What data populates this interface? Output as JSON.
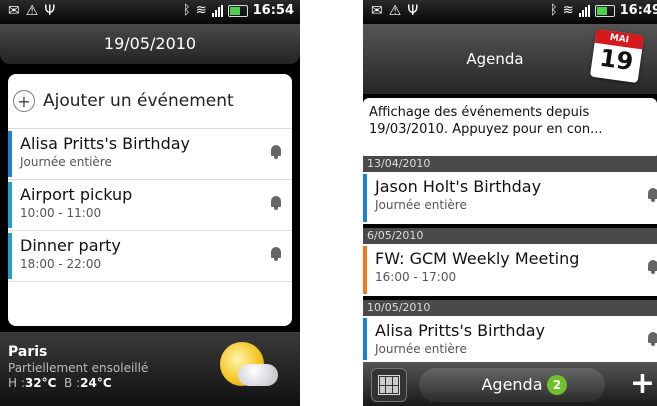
{
  "left": {
    "status_time": "16:54",
    "date": "19/05/2010",
    "add_event_label": "Ajouter un événement",
    "events": [
      {
        "title": "Alisa Pritts's Birthday",
        "time": "Journée entière",
        "color": "#1d7fd1"
      },
      {
        "title": "Airport pickup",
        "time": "10:00 - 11:00",
        "color": "#21a0c9"
      },
      {
        "title": "Dinner party",
        "time": "18:00 - 22:00",
        "color": "#21a0c9"
      }
    ],
    "weather": {
      "city": "Paris",
      "description": "Partiellement ensoleillé",
      "high_label": "H :",
      "high": "32°C",
      "low_label": "B :",
      "low": "24°C"
    }
  },
  "right": {
    "status_time": "16:49",
    "header_title": "Agenda",
    "calendar_icon": {
      "month": "MAI",
      "day": "19"
    },
    "info_text": "Affichage des événements depuis 19/03/2010. Appuyez pour en con...",
    "groups": [
      {
        "date": "13/04/2010",
        "title": "Jason Holt's Birthday",
        "time": "Journée entière",
        "color": "#1d7fd1"
      },
      {
        "date": "6/05/2010",
        "title": "FW: GCM Weekly Meeting",
        "time": "16:00 - 17:00",
        "color": "#f07a1c"
      },
      {
        "date": "10/05/2010",
        "title": "Alisa Pritts's Birthday",
        "time": "Journée entière",
        "color": "#1d7fd1"
      }
    ],
    "bottom_label": "Agenda",
    "bottom_count": "2"
  },
  "icons": [
    "mail-icon",
    "warning-icon",
    "usb-icon",
    "bluetooth-icon",
    "wifi-icon",
    "signal-icon",
    "battery-icon",
    "bell-icon",
    "add-icon",
    "weather-sun-cloud-icon",
    "calendar-icon",
    "calendar-grid-icon"
  ]
}
